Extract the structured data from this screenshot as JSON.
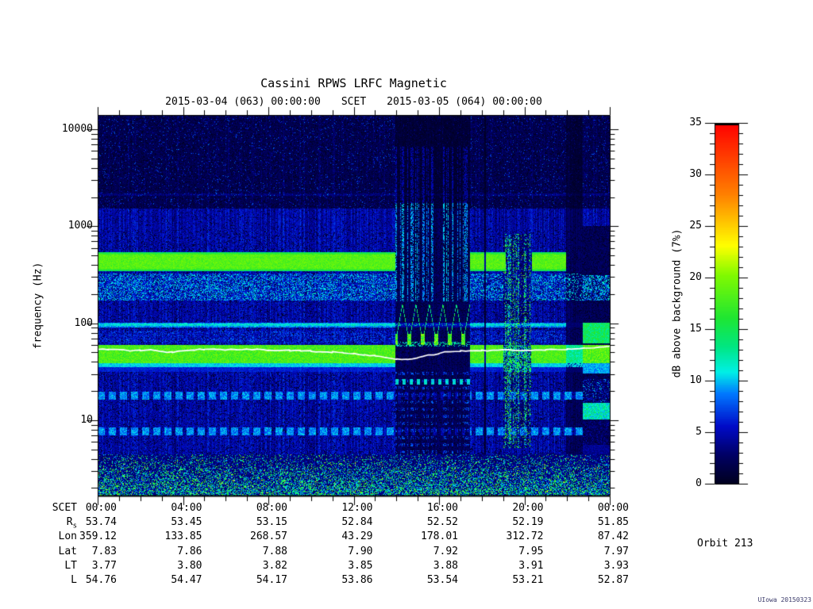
{
  "title": "Cassini RPWS LRFC Magnetic",
  "subtitle": {
    "left": "2015-03-04 (063) 00:00:00",
    "center": "SCET",
    "right": "2015-03-05 (064) 00:00:00"
  },
  "y_axis": {
    "label": "frequency (Hz)",
    "tick_labels": [
      "10000",
      "1000",
      "100",
      "10"
    ],
    "tick_values": [
      10000,
      1000,
      100,
      10
    ]
  },
  "colorbar": {
    "label": "dB above background (7%)",
    "tick_values": [
      35,
      30,
      25,
      20,
      15,
      10,
      5,
      0
    ],
    "min": 0,
    "max": 35,
    "colormap_stops": [
      [
        0.0,
        "#00001e"
      ],
      [
        0.08,
        "#000064"
      ],
      [
        0.16,
        "#000ac8"
      ],
      [
        0.25,
        "#0078ff"
      ],
      [
        0.31,
        "#00f0e6"
      ],
      [
        0.38,
        "#00e682"
      ],
      [
        0.46,
        "#1ee632"
      ],
      [
        0.58,
        "#82fa00"
      ],
      [
        0.66,
        "#ffff00"
      ],
      [
        0.8,
        "#ff8200"
      ],
      [
        1.0,
        "#ff0000"
      ]
    ]
  },
  "ephemeris": {
    "rows": [
      {
        "label": "SCET",
        "sub": "",
        "values": [
          "00:00",
          "04:00",
          "08:00",
          "12:00",
          "16:00",
          "20:00",
          "00:00"
        ]
      },
      {
        "label": "R",
        "sub": "s",
        "values": [
          "53.74",
          "53.45",
          "53.15",
          "52.84",
          "52.52",
          "52.19",
          "51.85"
        ]
      },
      {
        "label": "Lon",
        "sub": "",
        "values": [
          "359.12",
          "133.85",
          "268.57",
          "43.29",
          "178.01",
          "312.72",
          "87.42"
        ]
      },
      {
        "label": "Lat",
        "sub": "",
        "values": [
          "7.83",
          "7.86",
          "7.88",
          "7.90",
          "7.92",
          "7.95",
          "7.97"
        ]
      },
      {
        "label": "LT",
        "sub": "",
        "values": [
          "3.77",
          "3.80",
          "3.82",
          "3.85",
          "3.88",
          "3.91",
          "3.93"
        ]
      },
      {
        "label": "L",
        "sub": "",
        "values": [
          "54.76",
          "54.47",
          "54.17",
          "53.86",
          "53.54",
          "53.21",
          "52.87"
        ]
      }
    ]
  },
  "annotations": {
    "orbit": "Orbit 213",
    "stamp": "UIowa 20150323"
  },
  "chart_data": {
    "type": "heatmap",
    "title": "Cassini RPWS LRFC Magnetic",
    "x_label": "SCET",
    "x_start": "2015-03-04 (063) 00:00:00",
    "x_end": "2015-03-05 (064) 00:00:00",
    "x_range_hours": [
      0,
      24
    ],
    "x_tick_hours": [
      0,
      4,
      8,
      12,
      16,
      20,
      24
    ],
    "x_minor_tick_hours": 1,
    "y_label": "frequency (Hz)",
    "y_scale": "log",
    "y_range_hz": [
      1.67,
      14060
    ],
    "value_label": "dB above background (7%)",
    "value_range_db": [
      0,
      35
    ],
    "bands": [
      {
        "name": "narrowband-emission",
        "f_lo": 380,
        "f_hi": 490,
        "db": 16,
        "present_hours": [
          [
            0,
            13.95
          ],
          [
            17.5,
            19.1
          ],
          [
            20.35,
            21.95
          ]
        ]
      },
      {
        "name": "diffuse-speckle",
        "f_lo": 180,
        "f_hi": 330,
        "db": 9,
        "texture": "speckle"
      },
      {
        "name": "thin-line",
        "f_lo": 88,
        "f_hi": 98,
        "db": 10
      },
      {
        "name": "speckle-low",
        "f_lo": 66,
        "f_hi": 86,
        "db": 7,
        "texture": "speckle"
      },
      {
        "name": "intense-band",
        "f_lo": 40,
        "f_hi": 57,
        "db": 18,
        "present_hours": [
          [
            0,
            13.95
          ],
          [
            17.5,
            24
          ]
        ]
      },
      {
        "name": "dashed-17hz",
        "f_lo": 15.5,
        "f_hi": 18.5,
        "db": 9,
        "texture": "dashed"
      },
      {
        "name": "dashed-7.5hz",
        "f_lo": 7.0,
        "f_hi": 8.3,
        "db": 9,
        "texture": "dashed"
      },
      {
        "name": "low-freq-noise",
        "f_lo": 1.67,
        "f_hi": 4.2,
        "db": 14,
        "texture": "speckle-dense"
      }
    ],
    "disturbances": [
      {
        "name": "interference-A",
        "hours": [
          13.95,
          17.45
        ],
        "desc": "vertical striping, zigzag fishbone 60-120 Hz"
      },
      {
        "name": "interference-B",
        "hours": [
          19.0,
          20.3
        ],
        "desc": "chaotic vertical wisps"
      },
      {
        "name": "quiet-gap",
        "hours": [
          21.95,
          22.7
        ],
        "desc": "attenuated background"
      },
      {
        "name": "shifted-bands",
        "hours": [
          22.72,
          24
        ],
        "desc": "bands shifted to 35-100 Hz"
      }
    ],
    "white_line_hz": [
      [
        0,
        53
      ],
      [
        0.5,
        54
      ],
      [
        1,
        53.5
      ],
      [
        1.5,
        52
      ],
      [
        2,
        52.5
      ],
      [
        2.5,
        53
      ],
      [
        3,
        51
      ],
      [
        3.5,
        50.5
      ],
      [
        4,
        51.5
      ],
      [
        4.5,
        53
      ],
      [
        5,
        54
      ],
      [
        5.5,
        54.5
      ],
      [
        6,
        53.5
      ],
      [
        6.5,
        53
      ],
      [
        7,
        53.5
      ],
      [
        7.5,
        54
      ],
      [
        8,
        53
      ],
      [
        8.5,
        52
      ],
      [
        9,
        52.5
      ],
      [
        9.5,
        52
      ],
      [
        10,
        51.5
      ],
      [
        10.5,
        51
      ],
      [
        11,
        50.5
      ],
      [
        11.5,
        50
      ],
      [
        12,
        49
      ],
      [
        12.5,
        47.5
      ],
      [
        13,
        46
      ],
      [
        13.5,
        44.5
      ],
      [
        14,
        43
      ],
      [
        14.5,
        42.5
      ],
      [
        15,
        44
      ],
      [
        15.5,
        46.5
      ],
      [
        16,
        49
      ],
      [
        16.5,
        51
      ],
      [
        17,
        52
      ],
      [
        17.5,
        52.5
      ],
      [
        18,
        52.5
      ],
      [
        19,
        53
      ],
      [
        20,
        53
      ],
      [
        21,
        53.5
      ],
      [
        22,
        54
      ],
      [
        22.8,
        55
      ],
      [
        23.5,
        56
      ],
      [
        24,
        57
      ]
    ]
  }
}
